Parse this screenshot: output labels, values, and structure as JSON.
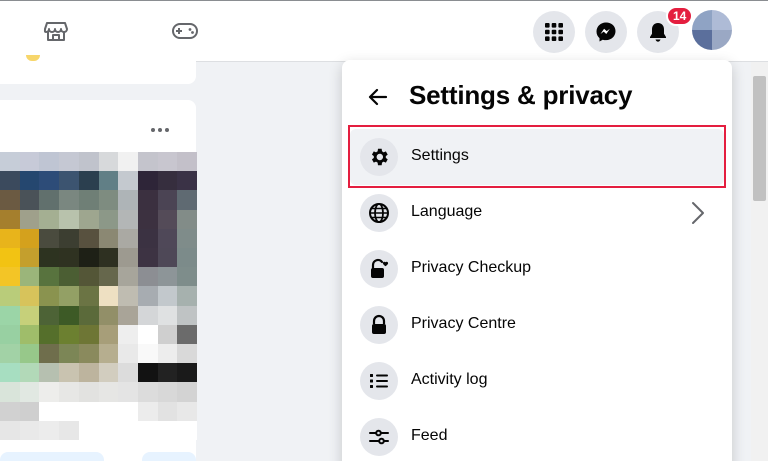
{
  "topbar": {
    "nav_icons": [
      "marketplace-icon",
      "gaming-icon"
    ],
    "actions": [
      "menu-grid-icon",
      "messenger-icon",
      "notifications-icon"
    ],
    "notification_count": "14"
  },
  "feed": {
    "post_more_icon": "more-dots-icon"
  },
  "settings_panel": {
    "title": "Settings & privacy",
    "back_icon": "back-arrow-icon",
    "items": [
      {
        "label": "Settings",
        "icon": "gear-icon",
        "selected": true
      },
      {
        "label": "Language",
        "icon": "globe-icon",
        "has_submenu": true
      },
      {
        "label": "Privacy Checkup",
        "icon": "lock-heart-icon"
      },
      {
        "label": "Privacy Centre",
        "icon": "lock-icon"
      },
      {
        "label": "Activity log",
        "icon": "list-icon"
      },
      {
        "label": "Feed",
        "icon": "sliders-icon"
      }
    ]
  },
  "colors": {
    "highlight": "#e41e3f",
    "badge": "#e41e3f",
    "icon_bg": "#e4e6eb",
    "page_bg": "#f0f2f5"
  }
}
